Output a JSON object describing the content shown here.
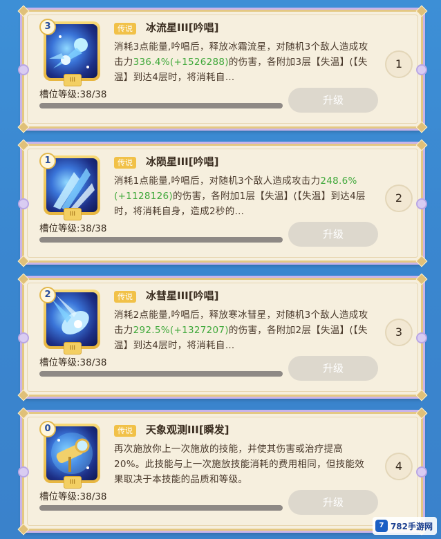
{
  "skills": [
    {
      "count": "3",
      "tag": "传说",
      "title": "冰流星III[吟唱]",
      "icon": "comet-shower-icon",
      "icon_tier": "III",
      "desc": [
        {
          "t": "消耗3点能量,吟唱后，释放冰霜流星，对随机3个敌人造成攻击力"
        },
        {
          "t": "336.4%(+1526288)",
          "hl": true
        },
        {
          "t": "的伤害，各附加3层【失温】(【失温】到达4层时，将消耗自…"
        }
      ],
      "slot": "槽位等级:38/38",
      "upgrade": "升级",
      "order": "1"
    },
    {
      "count": "1",
      "tag": "传说",
      "title": "冰陨星III[吟唱]",
      "icon": "ice-meteor-icon",
      "icon_tier": "III",
      "desc": [
        {
          "t": "消耗1点能量,吟唱后，对随机3个敌人造成攻击力"
        },
        {
          "t": "248.6%(+1128126)",
          "hl": true
        },
        {
          "t": "的伤害，各附加1层【失温】(【失温】到达4层时，将消耗自身，造成2秒的…"
        }
      ],
      "slot": "槽位等级:38/38",
      "upgrade": "升级",
      "order": "2"
    },
    {
      "count": "2",
      "tag": "传说",
      "title": "冰彗星III[吟唱]",
      "icon": "ice-comet-icon",
      "icon_tier": "III",
      "desc": [
        {
          "t": "消耗2点能量,吟唱后，释放寒冰彗星，对随机3个敌人造成攻击力"
        },
        {
          "t": "292.5%(+1327207)",
          "hl": true
        },
        {
          "t": "的伤害，各附加2层【失温】(【失温】到达4层时，将消耗自…"
        }
      ],
      "slot": "槽位等级:38/38",
      "upgrade": "升级",
      "order": "3"
    },
    {
      "count": "0",
      "tag": "传说",
      "title": "天象观测III[瞬发]",
      "icon": "telescope-icon",
      "icon_tier": "III",
      "desc": [
        {
          "t": "再次施放你上一次施放的技能，并使其伤害或治疗提高20%。此技能与上一次施放技能消耗的费用相同，但技能效果取决于本技能的品质和等级。"
        }
      ],
      "slot": "槽位等级:38/38",
      "upgrade": "升级",
      "order": "4"
    }
  ],
  "watermark": {
    "logo": "7",
    "text": "782手游网"
  }
}
